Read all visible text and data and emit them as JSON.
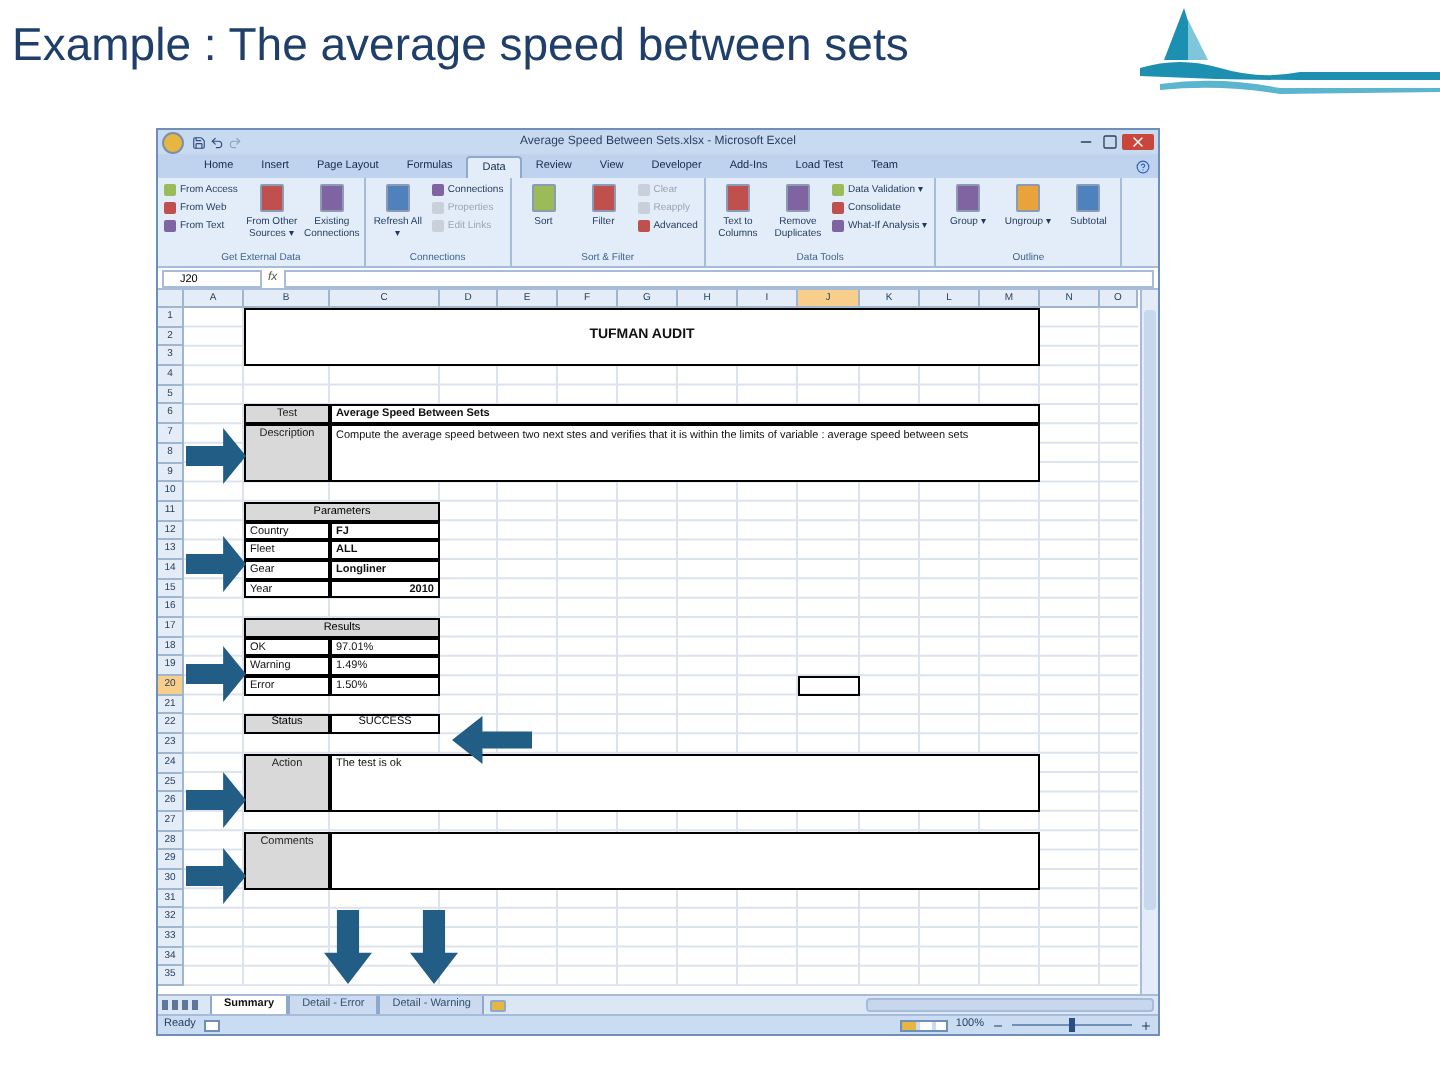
{
  "slide_title": "Example : The average speed between sets",
  "window": {
    "title": "Average Speed Between Sets.xlsx - Microsoft Excel"
  },
  "tabs": [
    {
      "label": "Home",
      "selected": false
    },
    {
      "label": "Insert",
      "selected": false
    },
    {
      "label": "Page Layout",
      "selected": false
    },
    {
      "label": "Formulas",
      "selected": false
    },
    {
      "label": "Data",
      "selected": true
    },
    {
      "label": "Review",
      "selected": false
    },
    {
      "label": "View",
      "selected": false
    },
    {
      "label": "Developer",
      "selected": false
    },
    {
      "label": "Add-Ins",
      "selected": false
    },
    {
      "label": "Load Test",
      "selected": false
    },
    {
      "label": "Team",
      "selected": false
    }
  ],
  "ribbon_groups": [
    {
      "label": "Get External Data",
      "items": [
        {
          "label": "From Access",
          "kind": "small",
          "disabled": false
        },
        {
          "label": "From Web",
          "kind": "small",
          "disabled": false
        },
        {
          "label": "From Text",
          "kind": "small",
          "disabled": false
        },
        {
          "label": "From Other Sources ▾",
          "kind": "large",
          "disabled": false
        },
        {
          "label": "Existing Connections",
          "kind": "large",
          "disabled": false
        }
      ]
    },
    {
      "label": "Connections",
      "items": [
        {
          "label": "Refresh All ▾",
          "kind": "large",
          "disabled": false
        },
        {
          "label": "Connections",
          "kind": "small",
          "disabled": false
        },
        {
          "label": "Properties",
          "kind": "small",
          "disabled": true
        },
        {
          "label": "Edit Links",
          "kind": "small",
          "disabled": true
        }
      ]
    },
    {
      "label": "Sort & Filter",
      "items": [
        {
          "label": "Sort",
          "kind": "large",
          "disabled": false
        },
        {
          "label": "Filter",
          "kind": "large",
          "disabled": false
        },
        {
          "label": "Clear",
          "kind": "small",
          "disabled": true
        },
        {
          "label": "Reapply",
          "kind": "small",
          "disabled": true
        },
        {
          "label": "Advanced",
          "kind": "small",
          "disabled": false
        }
      ]
    },
    {
      "label": "Data Tools",
      "items": [
        {
          "label": "Text to Columns",
          "kind": "large",
          "disabled": false
        },
        {
          "label": "Remove Duplicates",
          "kind": "large",
          "disabled": false
        },
        {
          "label": "Data Validation ▾",
          "kind": "small",
          "disabled": false
        },
        {
          "label": "Consolidate",
          "kind": "small",
          "disabled": false
        },
        {
          "label": "What-If Analysis ▾",
          "kind": "small",
          "disabled": false
        }
      ]
    },
    {
      "label": "Outline",
      "items": [
        {
          "label": "Group ▾",
          "kind": "large",
          "disabled": false
        },
        {
          "label": "Ungroup ▾",
          "kind": "large",
          "disabled": false
        },
        {
          "label": "Subtotal",
          "kind": "large",
          "disabled": false
        }
      ]
    }
  ],
  "formula_bar": {
    "name_box": "J20",
    "fx": "fx"
  },
  "sheet": {
    "columns": [
      {
        "label": "A",
        "selected": false
      },
      {
        "label": "B",
        "selected": false
      },
      {
        "label": "C",
        "selected": false
      },
      {
        "label": "D",
        "selected": false
      },
      {
        "label": "E",
        "selected": false
      },
      {
        "label": "F",
        "selected": false
      },
      {
        "label": "G",
        "selected": false
      },
      {
        "label": "H",
        "selected": false
      },
      {
        "label": "I",
        "selected": false
      },
      {
        "label": "J",
        "selected": true
      },
      {
        "label": "K",
        "selected": false
      },
      {
        "label": "L",
        "selected": false
      },
      {
        "label": "M",
        "selected": false
      },
      {
        "label": "N",
        "selected": false
      },
      {
        "label": "O",
        "selected": false
      }
    ],
    "rows": [
      {
        "label": "1",
        "selected": false
      },
      {
        "label": "2",
        "selected": false
      },
      {
        "label": "3",
        "selected": false
      },
      {
        "label": "4",
        "selected": false
      },
      {
        "label": "5",
        "selected": false
      },
      {
        "label": "6",
        "selected": false
      },
      {
        "label": "7",
        "selected": false
      },
      {
        "label": "8",
        "selected": false
      },
      {
        "label": "9",
        "selected": false
      },
      {
        "label": "10",
        "selected": false
      },
      {
        "label": "11",
        "selected": false
      },
      {
        "label": "12",
        "selected": false
      },
      {
        "label": "13",
        "selected": false
      },
      {
        "label": "14",
        "selected": false
      },
      {
        "label": "15",
        "selected": false
      },
      {
        "label": "16",
        "selected": false
      },
      {
        "label": "17",
        "selected": false
      },
      {
        "label": "18",
        "selected": false
      },
      {
        "label": "19",
        "selected": false
      },
      {
        "label": "20",
        "selected": true
      },
      {
        "label": "21",
        "selected": false
      },
      {
        "label": "22",
        "selected": false
      },
      {
        "label": "23",
        "selected": false
      },
      {
        "label": "24",
        "selected": false
      },
      {
        "label": "25",
        "selected": false
      },
      {
        "label": "26",
        "selected": false
      },
      {
        "label": "27",
        "selected": false
      },
      {
        "label": "28",
        "selected": false
      },
      {
        "label": "29",
        "selected": false
      },
      {
        "label": "30",
        "selected": false
      },
      {
        "label": "31",
        "selected": false
      },
      {
        "label": "32",
        "selected": false
      },
      {
        "label": "33",
        "selected": false
      },
      {
        "label": "34",
        "selected": false
      },
      {
        "label": "35",
        "selected": false
      }
    ],
    "title": "TUFMAN AUDIT",
    "test": {
      "label": "Test",
      "value": "Average Speed Between Sets"
    },
    "description": {
      "label": "Description",
      "value": "Compute the average speed between two next stes and verifies that it is within the limits of variable : average speed between sets"
    },
    "parameters": {
      "header": "Parameters",
      "rows": [
        {
          "label": "Country",
          "value": "FJ",
          "kind": "text"
        },
        {
          "label": "Fleet",
          "value": "ALL",
          "kind": "text"
        },
        {
          "label": "Gear",
          "value": "Longliner",
          "kind": "text"
        },
        {
          "label": "Year",
          "value": "2010",
          "kind": "number"
        }
      ]
    },
    "results": {
      "header": "Results",
      "rows": [
        {
          "label": "OK",
          "value": "97.01%"
        },
        {
          "label": "Warning",
          "value": "1.49%"
        },
        {
          "label": "Error",
          "value": "1.50%"
        }
      ]
    },
    "status": {
      "label": "Status",
      "value": "SUCCESS"
    },
    "action": {
      "label": "Action",
      "value": "The test is ok"
    },
    "comments": {
      "label": "Comments"
    }
  },
  "sheet_tabs": [
    {
      "label": "Summary",
      "selected": true
    },
    {
      "label": "Detail - Error",
      "selected": false
    },
    {
      "label": "Detail - Warning",
      "selected": false
    }
  ],
  "status_bar": {
    "text": "Ready",
    "zoom": "100%"
  },
  "zoom_slider": {
    "level": 0.5
  }
}
